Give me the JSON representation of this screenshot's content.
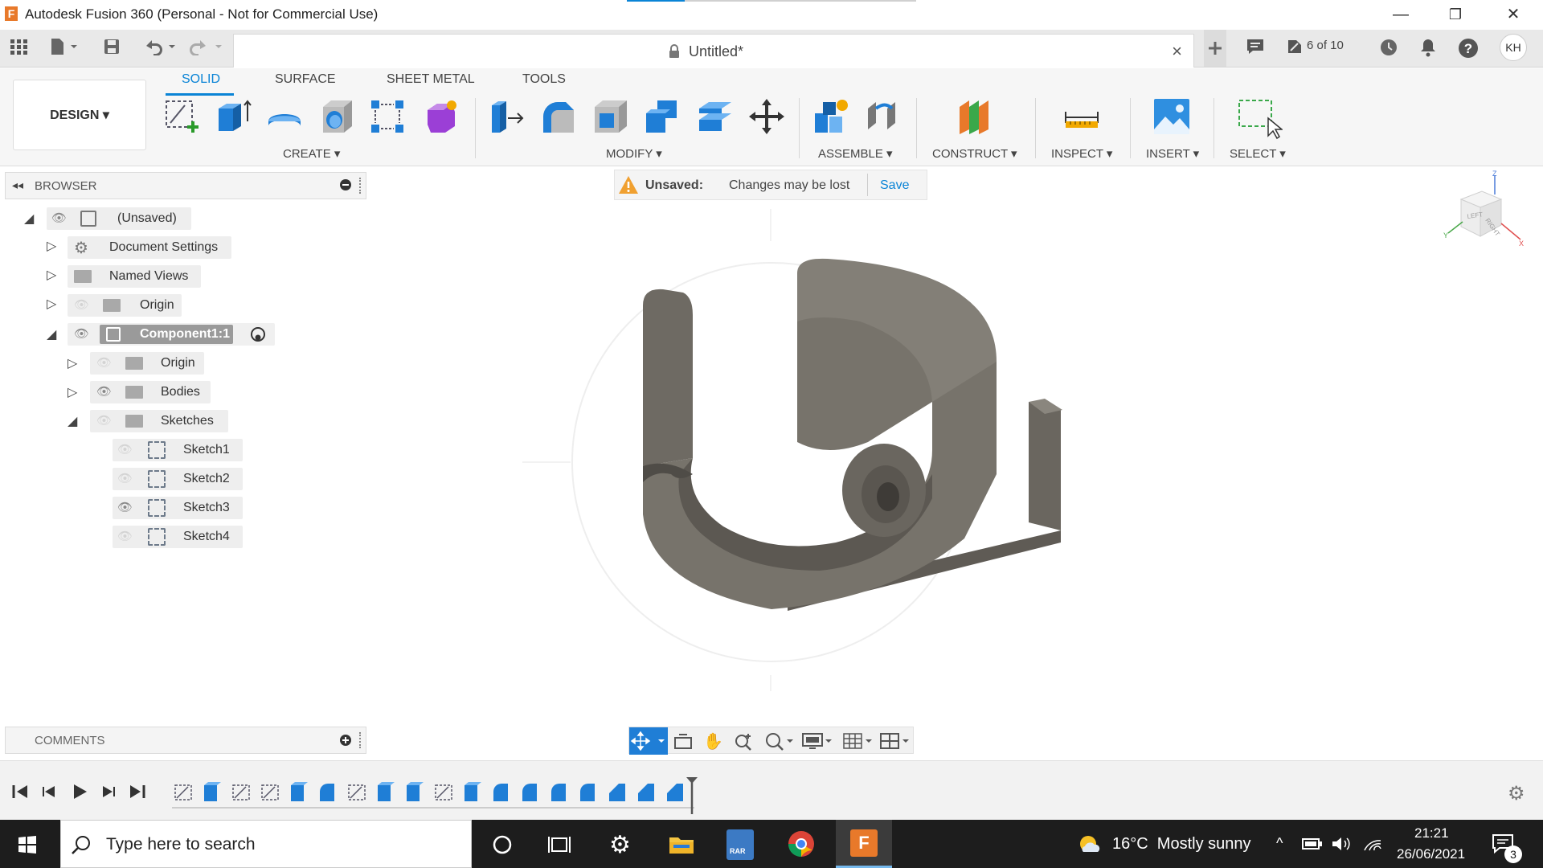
{
  "window": {
    "app_logo": "F",
    "title": "Autodesk Fusion 360 (Personal - Not for Commercial Use)",
    "controls": {
      "minimize": "—",
      "maximize": "❐",
      "close": "✕"
    }
  },
  "document": {
    "tab_name": "Untitled*",
    "job_status": "6 of 10",
    "user_initials": "KH"
  },
  "ribbon": {
    "workspace": "DESIGN",
    "tabs": [
      "SOLID",
      "SURFACE",
      "SHEET METAL",
      "TOOLS"
    ],
    "active_tab": "SOLID",
    "groups": [
      "CREATE",
      "MODIFY",
      "ASSEMBLE",
      "CONSTRUCT",
      "INSPECT",
      "INSERT",
      "SELECT"
    ]
  },
  "browser": {
    "header": "BROWSER",
    "root": "(Unsaved)",
    "items": {
      "document_settings": "Document Settings",
      "named_views": "Named Views",
      "origin": "Origin",
      "component": "Component1:1",
      "comp_origin": "Origin",
      "bodies": "Bodies",
      "sketches": "Sketches",
      "sketch1": "Sketch1",
      "sketch2": "Sketch2",
      "sketch3": "Sketch3",
      "sketch4": "Sketch4"
    }
  },
  "warning": {
    "label": "Unsaved:",
    "message": "Changes may be lost",
    "action": "Save"
  },
  "viewcube": {
    "left": "LEFT",
    "right": "RIGHT",
    "z": "Z",
    "x": "X",
    "y": "Y"
  },
  "comments": {
    "header": "COMMENTS"
  },
  "taskbar": {
    "search_placeholder": "Type here to search",
    "weather": "16°C  Mostly sunny",
    "time": "21:21",
    "date": "26/06/2021",
    "notification_count": "3",
    "rar_label": "RAR"
  },
  "colors": {
    "accent": "#0a84d6",
    "model": "#77736b",
    "warning": "#f0a030",
    "taskbar": "#1d1d1d"
  }
}
